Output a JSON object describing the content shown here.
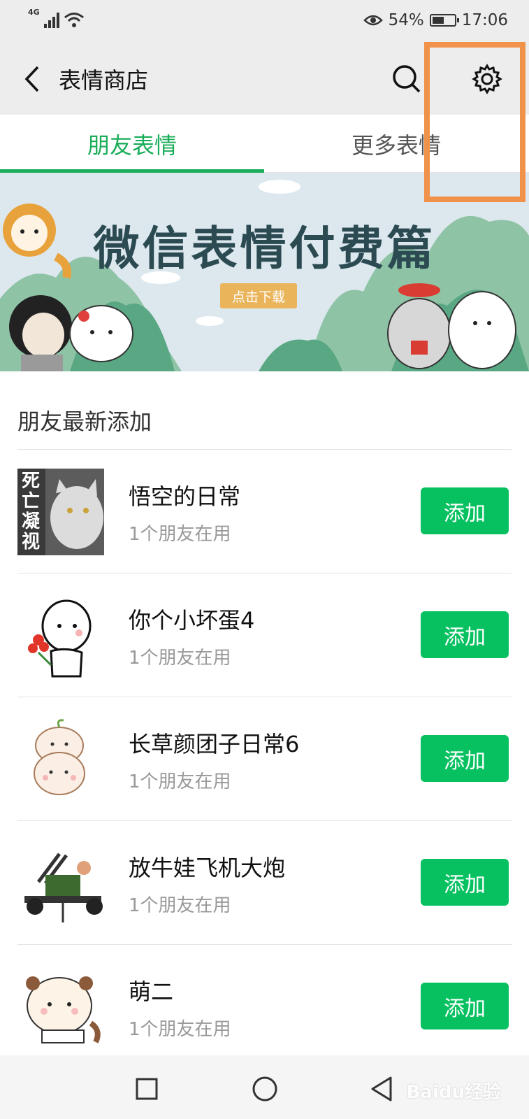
{
  "status_bar": {
    "network": "4G",
    "battery_percent": 54,
    "battery_label": "54%",
    "time": "17:06"
  },
  "header": {
    "title": "表情商店"
  },
  "tabs": [
    {
      "label": "朋友表情",
      "active": true
    },
    {
      "label": "更多表情",
      "active": false
    }
  ],
  "banner": {
    "title": "微信表情付费篇",
    "button_label": "点击下载"
  },
  "section": {
    "title": "朋友最新添加"
  },
  "items": [
    {
      "name": "悟空的日常",
      "usage": "1个朋友在用",
      "add_label": "添加",
      "thumb_text": [
        "死",
        "亡",
        "凝",
        "视"
      ]
    },
    {
      "name": "你个小坏蛋4",
      "usage": "1个朋友在用",
      "add_label": "添加"
    },
    {
      "name": "长草颜团子日常6",
      "usage": "1个朋友在用",
      "add_label": "添加"
    },
    {
      "name": "放牛娃飞机大炮",
      "usage": "1个朋友在用",
      "add_label": "添加"
    },
    {
      "name": "萌二",
      "usage": "1个朋友在用",
      "add_label": "添加"
    }
  ],
  "watermark": "Baidu经验",
  "colors": {
    "accent_green": "#07c160",
    "tab_green": "#1aad5a",
    "highlight_orange": "#f0924a",
    "header_bg": "#ededed"
  }
}
